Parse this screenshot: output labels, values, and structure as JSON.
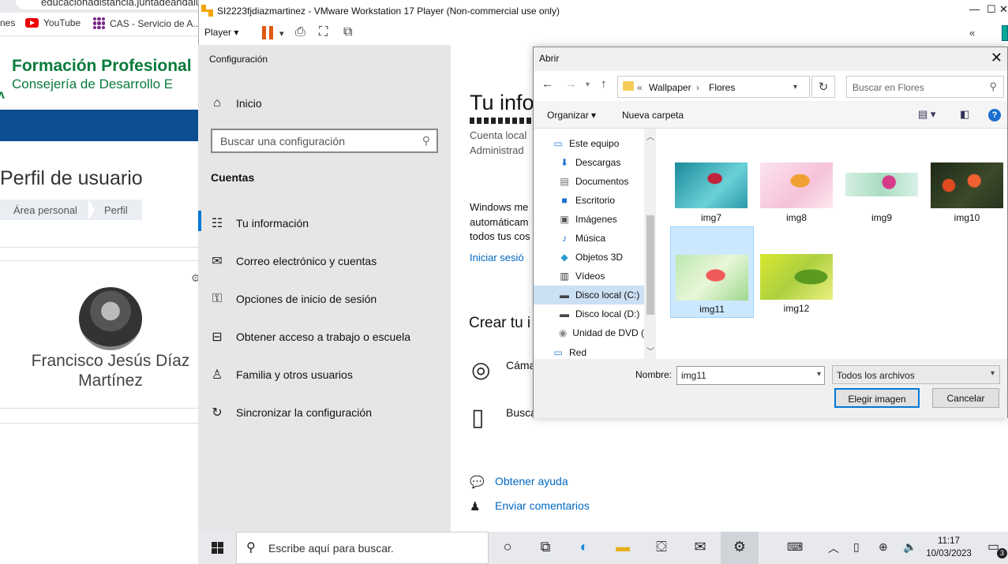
{
  "browser": {
    "address": "educacionadistancia.juntadeandalucia.es",
    "bookmarks": [
      {
        "label": "nes",
        "icon": "bookmark-icon"
      },
      {
        "label": "YouTube",
        "icon": "youtube-icon"
      },
      {
        "label": "CAS - Servicio de A...",
        "icon": "cas-icon"
      }
    ],
    "logo_line1": "Formación Profesional",
    "logo_line2": "Consejería de Desarrollo E",
    "page_title": "Perfil de usuario",
    "breadcrumb": [
      "Área personal",
      "Perfil"
    ],
    "user_name": "Francisco Jesús Díaz Martínez"
  },
  "vmware": {
    "title": "SI2223fjdiazmartinez - VMware Workstation 17 Player (Non-commercial use only)",
    "player_menu": "Player",
    "controls": [
      "—",
      "☐",
      "✕"
    ]
  },
  "settings": {
    "header": "Configuración",
    "home": "Inicio",
    "search_placeholder": "Buscar una configuración",
    "section": "Cuentas",
    "nav": [
      {
        "label": "Tu información",
        "icon": "person-card-icon"
      },
      {
        "label": "Correo electrónico y cuentas",
        "icon": "mail-icon"
      },
      {
        "label": "Opciones de inicio de sesión",
        "icon": "key-icon"
      },
      {
        "label": "Obtener acceso a trabajo o escuela",
        "icon": "briefcase-icon"
      },
      {
        "label": "Familia y otros usuarios",
        "icon": "person-add-icon"
      },
      {
        "label": "Sincronizar la configuración",
        "icon": "sync-icon"
      }
    ],
    "main": {
      "title": "Tu info",
      "account_type": "Cuenta local",
      "role": "Administrad",
      "windows_text": [
        "Windows me",
        "automáticam",
        "todos tus cos"
      ],
      "signin_link": "Iniciar sesió",
      "create_title": "Crear tu i",
      "camera_label": "Cáma",
      "browse_label": "Busca",
      "help_link": "Obtener ayuda",
      "feedback_link": "Enviar comentarios"
    }
  },
  "dialog": {
    "title": "Abrir",
    "path": [
      "Wallpaper",
      "Flores"
    ],
    "search_placeholder": "Buscar en Flores",
    "organize": "Organizar",
    "new_folder": "Nueva carpeta",
    "help": "?",
    "tree": [
      {
        "label": "Este equipo",
        "icon": "computer-icon"
      },
      {
        "label": "Descargas",
        "icon": "download-icon"
      },
      {
        "label": "Documentos",
        "icon": "document-icon"
      },
      {
        "label": "Escritorio",
        "icon": "desktop-icon"
      },
      {
        "label": "Imágenes",
        "icon": "pictures-icon"
      },
      {
        "label": "Música",
        "icon": "music-icon"
      },
      {
        "label": "Objetos 3D",
        "icon": "cube-icon"
      },
      {
        "label": "Vídeos",
        "icon": "video-icon"
      },
      {
        "label": "Disco local (C:)",
        "icon": "drive-icon"
      },
      {
        "label": "Disco local (D:)",
        "icon": "drive-icon"
      },
      {
        "label": "Unidad de DVD (",
        "icon": "dvd-icon"
      },
      {
        "label": "Red",
        "icon": "network-icon"
      }
    ],
    "selected_tree": "Disco local (C:)",
    "files": [
      "img7",
      "img8",
      "img9",
      "img10",
      "img11",
      "img12"
    ],
    "selected_file": "img11",
    "filename_label": "Nombre:",
    "filename_value": "img11",
    "filetype": "Todos los archivos",
    "ok_button": "Elegir imagen",
    "cancel_button": "Cancelar"
  },
  "taskbar": {
    "search_placeholder": "Escribe aquí para buscar.",
    "time": "11:17",
    "date": "10/03/2023",
    "notifications": "3",
    "colors": {
      "accent": "#0078d7",
      "vm_pause": "#e05a10"
    }
  }
}
